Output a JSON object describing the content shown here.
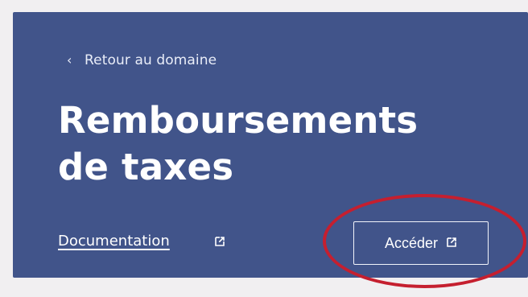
{
  "navigation": {
    "back_label": "Retour au domaine",
    "back_icon": "chevron-left-icon"
  },
  "page": {
    "title": "Remboursements de taxes"
  },
  "actions": {
    "documentation_label": "Documentation",
    "documentation_icon": "external-link-icon",
    "access_label": "Accéder",
    "access_icon": "external-link-icon"
  },
  "colors": {
    "card_background": "#41548a",
    "page_background": "#f1eff1",
    "highlight": "#c51f2f",
    "text": "#ffffff"
  }
}
